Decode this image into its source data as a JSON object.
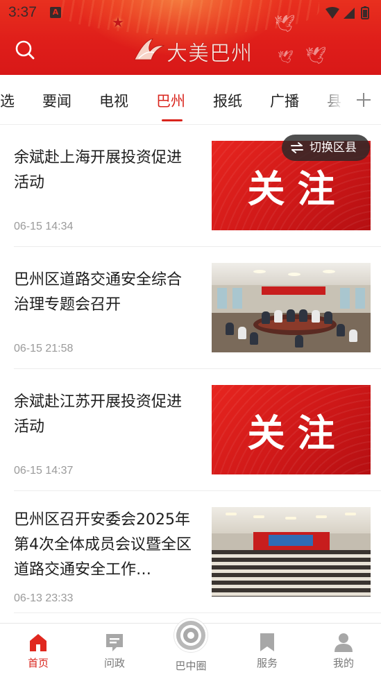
{
  "status_bar": {
    "time": "3:37",
    "indicator": "A",
    "icons": [
      "wifi-icon",
      "signal-icon",
      "battery-icon"
    ]
  },
  "header": {
    "app_name": "大美巴州",
    "search_icon": "search-icon",
    "colors": {
      "bg": "#df1e1a",
      "accent": "#d9241c"
    }
  },
  "tabs": {
    "items": [
      {
        "label": "选",
        "active": false
      },
      {
        "label": "要闻",
        "active": false
      },
      {
        "label": "电视",
        "active": false
      },
      {
        "label": "巴州",
        "active": true
      },
      {
        "label": "报纸",
        "active": false
      },
      {
        "label": "广播",
        "active": false
      },
      {
        "label": "县",
        "active": false
      }
    ],
    "add_icon": "plus-icon"
  },
  "switch_county": {
    "label": "切换区县",
    "icon": "swap-arrows-icon"
  },
  "news": [
    {
      "title": "余斌赴上海开展投资促进活动",
      "time": "06-15 14:34",
      "thumb": "关注",
      "thumb_type": "focus"
    },
    {
      "title": "巴州区道路交通安全综合治理专题会召开",
      "time": "06-15 21:58",
      "thumb_type": "meeting-photo"
    },
    {
      "title": "余斌赴江苏开展投资促进活动",
      "time": "06-15 14:37",
      "thumb": "关注",
      "thumb_type": "focus"
    },
    {
      "title": "巴州区召开安委会2025年第4次全体成员会议暨全区道路交通安全工作…",
      "time": "06-13 23:33",
      "thumb_type": "hall-photo"
    }
  ],
  "bottom_nav": [
    {
      "label": "首页",
      "icon": "home-icon",
      "active": true
    },
    {
      "label": "问政",
      "icon": "message-icon",
      "active": false
    },
    {
      "label": "巴中圈",
      "icon": "circle-icon",
      "active": false
    },
    {
      "label": "服务",
      "icon": "bookmark-icon",
      "active": false
    },
    {
      "label": "我的",
      "icon": "user-icon",
      "active": false
    }
  ]
}
